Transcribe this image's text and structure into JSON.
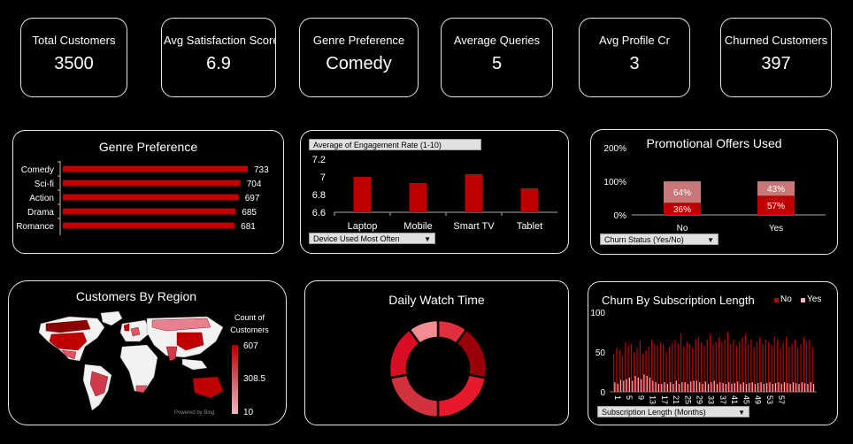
{
  "kpis": [
    {
      "title": "Total Customers",
      "value": "3500"
    },
    {
      "title": "Avg Satisfaction Score",
      "value": "6.9"
    },
    {
      "title": "Genre Preference",
      "value": "Comedy"
    },
    {
      "title": "Average Queries",
      "value": "5"
    },
    {
      "title": "Avg Profile Cr",
      "value": "3"
    },
    {
      "title": "Churned Customers",
      "value": "397"
    }
  ],
  "genre_panel": {
    "title": "Genre Preference"
  },
  "engagement_panel": {
    "field_button": "Average of Engagement Rate (1-10)",
    "filter_button": "Device Used Most Often"
  },
  "promo_panel": {
    "title": "Promotional Offers Used",
    "filter_button": "Churn Status (Yes/No)"
  },
  "region_panel": {
    "title": "Customers By Region",
    "legend_title": "Count of Customers",
    "legend_max": "607",
    "legend_mid": "308.5",
    "legend_min": "10",
    "credit": "Powered by Bing"
  },
  "watch_panel": {
    "title": "Daily Watch Time"
  },
  "churn_panel": {
    "title": "Churn By Subscription Length",
    "legend_no": "No",
    "legend_yes": "Yes",
    "filter_button": "Subscription Length (Months)"
  },
  "colors": {
    "accent": "#c00000",
    "light": "#f4b6c2",
    "background": "#000000",
    "border": "#e6e6e6"
  },
  "chart_data": [
    {
      "type": "bar",
      "title": "Genre Preference",
      "orientation": "horizontal",
      "categories": [
        "Comedy",
        "Sci-fi",
        "Action",
        "Drama",
        "Romance"
      ],
      "values": [
        733,
        704,
        697,
        685,
        681
      ]
    },
    {
      "type": "bar",
      "title": "",
      "categories": [
        "Laptop",
        "Mobile",
        "Smart TV",
        "Tablet"
      ],
      "values": [
        7.0,
        6.93,
        7.03,
        6.87
      ],
      "ylim": [
        6.6,
        7.2
      ],
      "yticks": [
        "7.2",
        "7",
        "6.8",
        "6.6"
      ]
    },
    {
      "type": "bar",
      "stacked": true,
      "title": "Promotional Offers Used",
      "categories": [
        "No",
        "Yes"
      ],
      "series": [
        {
          "name": "",
          "values": [
            36,
            57
          ],
          "labels": [
            "36%",
            "57%"
          ]
        },
        {
          "name": "",
          "values": [
            64,
            43
          ],
          "labels": [
            "64%",
            "43%"
          ]
        }
      ],
      "yticks": [
        "200%",
        "100%",
        "0%"
      ]
    },
    {
      "type": "pie",
      "donut": true,
      "title": "Daily Watch Time",
      "values": [
        10,
        18,
        22,
        22,
        18,
        10
      ],
      "colors": [
        "#e0303e",
        "#9a0008",
        "#e8192c",
        "#d2323e",
        "#d80e24",
        "#f48c94"
      ]
    },
    {
      "type": "bar",
      "title": "Churn By Subscription Length",
      "x_ticks": [
        "1",
        "5",
        "9",
        "13",
        "17",
        "21",
        "25",
        "29",
        "33",
        "37",
        "41",
        "45",
        "49",
        "53",
        "57"
      ],
      "yticks": [
        "100",
        "50",
        "0"
      ],
      "ylim": [
        0,
        100
      ],
      "series": [
        {
          "name": "No",
          "values": [
            48,
            55,
            52,
            45,
            62,
            58,
            60,
            50,
            55,
            64,
            48,
            52,
            57,
            66,
            60,
            58,
            63,
            60,
            50,
            56,
            62,
            65,
            61,
            73,
            57,
            63,
            60,
            55,
            66,
            69,
            62,
            58,
            66,
            72,
            60,
            63,
            69,
            63,
            66,
            76,
            60,
            65,
            58,
            63,
            69,
            72,
            60,
            66,
            56,
            63,
            69,
            60,
            66,
            63,
            59,
            69,
            66,
            55,
            62,
            69,
            57,
            60,
            66,
            55,
            60,
            69,
            63,
            66,
            56
          ]
        },
        {
          "name": "Yes",
          "values": [
            12,
            10,
            15,
            14,
            16,
            18,
            14,
            20,
            18,
            16,
            22,
            20,
            18,
            14,
            12,
            10,
            10,
            12,
            10,
            12,
            10,
            14,
            10,
            12,
            12,
            10,
            13,
            14,
            14,
            12,
            10,
            13,
            10,
            12,
            14,
            10,
            12,
            11,
            10,
            12,
            10,
            11,
            13,
            10,
            12,
            10,
            11,
            12,
            10,
            11,
            12,
            10,
            11,
            12,
            10,
            11,
            12,
            10,
            12,
            11,
            10,
            12,
            11,
            10,
            12,
            11,
            10,
            12,
            10
          ]
        }
      ]
    }
  ]
}
